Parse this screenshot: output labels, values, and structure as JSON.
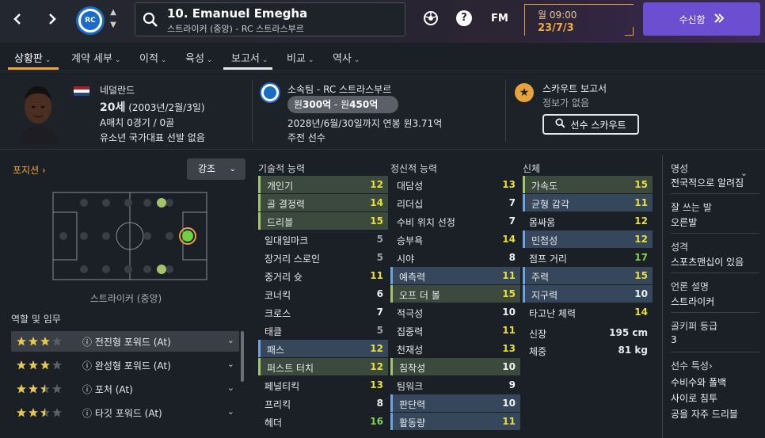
{
  "topbar": {
    "player_title": "10. Emanuel Emegha",
    "player_subtitle": "스트라이커 (중앙) - RC 스트라스부르",
    "club_badge_text": "RC",
    "fm_label": "FM",
    "date_time": "월 09:00",
    "date": "23/7/3",
    "inbox_label": "수신함",
    "icons": [
      "back-arrow-icon",
      "forward-arrow-icon",
      "search-icon",
      "ball-icon",
      "help-icon",
      "double-chevron-icon"
    ]
  },
  "tabs": [
    {
      "label": "상황판",
      "active": true
    },
    {
      "label": "계약 세부"
    },
    {
      "label": "이적"
    },
    {
      "label": "육성"
    },
    {
      "label": "보고서",
      "underline": true
    },
    {
      "label": "비교"
    },
    {
      "label": "역사"
    }
  ],
  "info": {
    "nationality": "네덜란드",
    "age": "20세",
    "birth": "(2003년/2월/3일)",
    "a_caps": "A매치 0경기 / 0골",
    "youth_caps": "유소년 국가대표 선발 없음",
    "club": "소속팀 - RC 스트라스부르",
    "value_prefix": "원",
    "value_low": "300억",
    "value_sep": " - 원",
    "value_high": "450억",
    "contract": "2028년/6월/30일까지 연봉 원3.71억",
    "squad_status": "주전 선수",
    "scout_title": "스카우트 보고서",
    "scout_sub": "정보가 없음",
    "scout_button": "선수 스카우트"
  },
  "left": {
    "position_title": "포지션",
    "highlight_label": "강조",
    "pitch_label": "스트라이커 (중앙)",
    "roles_title": "역할 및 임무",
    "roles": [
      {
        "name": "전진형 포워드 (At)",
        "stars": 3,
        "selected": true
      },
      {
        "name": "완성형 포워드 (At)",
        "stars": 3
      },
      {
        "name": "포처 (At)",
        "stars": 2.5
      },
      {
        "name": "타깃 포워드 (At)",
        "stars": 2.5
      }
    ]
  },
  "attributes": {
    "technical_title": "기술적 능력",
    "mental_title": "정신적 능력",
    "physical_title": "신체",
    "technical": [
      {
        "name": "개인기",
        "value": "12",
        "hl": "g"
      },
      {
        "name": "골 결정력",
        "value": "14",
        "hl": "g"
      },
      {
        "name": "드리블",
        "value": "15",
        "hl": "g"
      },
      {
        "name": "일대일마크",
        "value": "5"
      },
      {
        "name": "장거리 스로인",
        "value": "5"
      },
      {
        "name": "중거리 슛",
        "value": "11"
      },
      {
        "name": "코너킥",
        "value": "6"
      },
      {
        "name": "크로스",
        "value": "7"
      },
      {
        "name": "태클",
        "value": "5"
      },
      {
        "name": "패스",
        "value": "12",
        "hl": "b"
      },
      {
        "name": "퍼스트 터치",
        "value": "12",
        "hl": "g"
      },
      {
        "name": "페널티킥",
        "value": "13"
      },
      {
        "name": "프리킥",
        "value": "8"
      },
      {
        "name": "헤더",
        "value": "16"
      }
    ],
    "mental": [
      {
        "name": "대담성",
        "value": "13"
      },
      {
        "name": "리더십",
        "value": "7"
      },
      {
        "name": "수비 위치 선정",
        "value": "7"
      },
      {
        "name": "승부욕",
        "value": "14"
      },
      {
        "name": "시야",
        "value": "8"
      },
      {
        "name": "예측력",
        "value": "11",
        "hl": "b"
      },
      {
        "name": "오프 더 볼",
        "value": "15",
        "hl": "g"
      },
      {
        "name": "적극성",
        "value": "10"
      },
      {
        "name": "집중력",
        "value": "11"
      },
      {
        "name": "천재성",
        "value": "13"
      },
      {
        "name": "침착성",
        "value": "10",
        "hl": "g"
      },
      {
        "name": "팀워크",
        "value": "9"
      },
      {
        "name": "판단력",
        "value": "10",
        "hl": "b"
      },
      {
        "name": "활동량",
        "value": "11",
        "hl": "b"
      }
    ],
    "physical": [
      {
        "name": "가속도",
        "value": "15",
        "hl": "g"
      },
      {
        "name": "균형 감각",
        "value": "11",
        "hl": "b"
      },
      {
        "name": "몸싸움",
        "value": "12"
      },
      {
        "name": "민첩성",
        "value": "12",
        "hl": "b"
      },
      {
        "name": "점프 거리",
        "value": "17"
      },
      {
        "name": "주력",
        "value": "15",
        "hl": "b"
      },
      {
        "name": "지구력",
        "value": "10",
        "hl": "b"
      },
      {
        "name": "타고난 체력",
        "value": "14"
      }
    ],
    "height_label": "신장",
    "height_value": "195 cm",
    "weight_label": "체중",
    "weight_value": "81 kg"
  },
  "right": {
    "reputation_label": "명성",
    "reputation_value": "전국적으로 알려짐",
    "foot_label": "잘 쓰는 발",
    "foot_value": "오른발",
    "personality_label": "성격",
    "personality_value": "스포츠맨십이 있음",
    "media_label": "언론 설명",
    "media_value": "스트라이커",
    "keeper_label": "골키퍼 등급",
    "keeper_value": "3",
    "traits_label": "선수 특성",
    "traits": [
      "수비수와 폴백",
      "사이로 침투",
      "공을 자주 드리블"
    ]
  },
  "colors": {
    "accent_orange": "#f0a93a",
    "inbox_purple": "#6b4fd0",
    "value_yellow": "#e8df3c",
    "value_green": "#7fd64a",
    "highlight_green": "#3c4a3e",
    "highlight_blue": "#36475c"
  }
}
